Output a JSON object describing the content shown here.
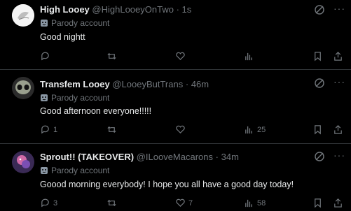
{
  "tweets": [
    {
      "name": "High Looey",
      "handle": "@HighLooeyOnTwo",
      "time": "1s",
      "badge": "Parody account",
      "text": "Good nightt",
      "replies": "",
      "retweets": "",
      "likes": "",
      "views": ""
    },
    {
      "name": "Transfem Looey",
      "handle": "@LooeyButTrans",
      "time": "46m",
      "badge": "Parody account",
      "text": "Good afternoon everyone!!!!!",
      "replies": "1",
      "retweets": "",
      "likes": "",
      "views": "25"
    },
    {
      "name": "Sprout!! (TAKEOVER)",
      "handle": "@ILooveMacarons",
      "time": "34m",
      "badge": "Parody account",
      "text": "Goood morning everybody! I hope you all have a good day today!",
      "replies": "3",
      "retweets": "",
      "likes": "7",
      "views": "58"
    }
  ],
  "separator": "·",
  "more_glyph": "···",
  "colors": {
    "background": "#000000",
    "text": "#e7e9ea",
    "muted": "#71767b",
    "border": "#2f3336"
  },
  "icons": [
    "parody-mask-icon",
    "grok-icon",
    "more-icon",
    "reply-icon",
    "retweet-icon",
    "like-icon",
    "views-icon",
    "bookmark-icon",
    "share-icon"
  ]
}
